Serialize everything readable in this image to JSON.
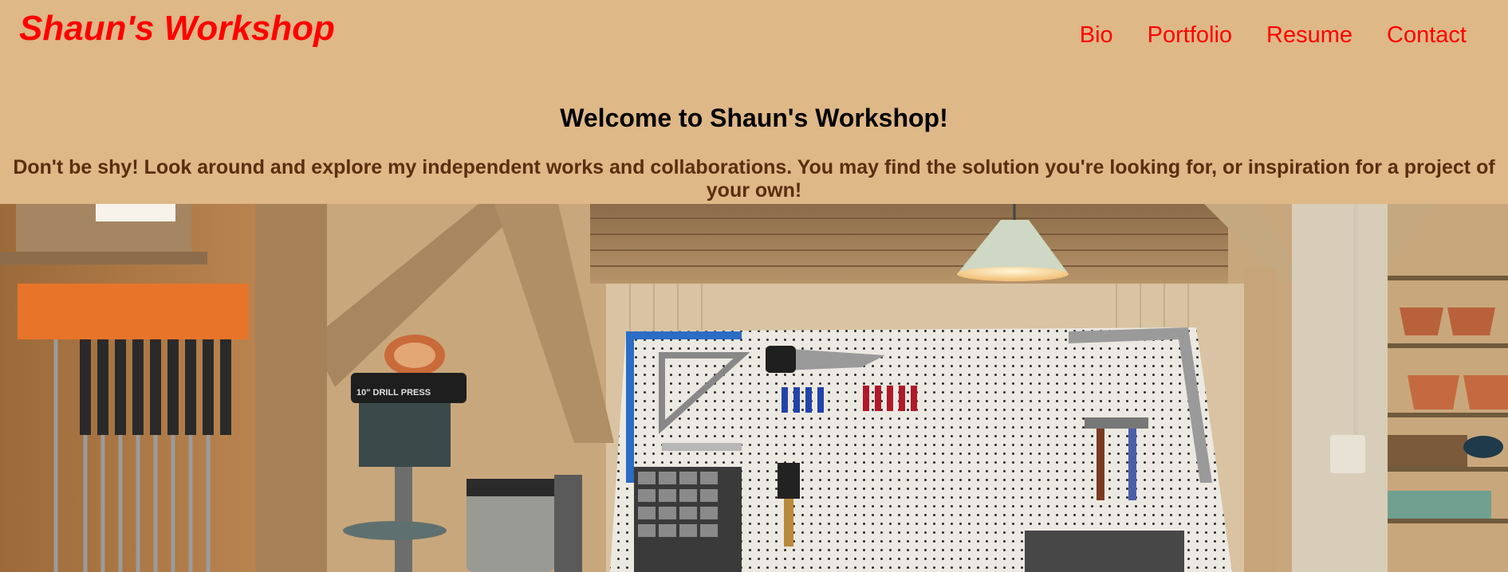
{
  "header": {
    "site_title": "Shaun's Workshop",
    "nav": [
      {
        "label": "Bio"
      },
      {
        "label": "Portfolio"
      },
      {
        "label": "Resume"
      },
      {
        "label": "Contact"
      }
    ]
  },
  "main": {
    "welcome_heading": "Welcome to Shaun's Workshop!",
    "intro_text": "Don't be shy! Look around and explore my independent works and collaborations. You may find the solution you're looking for, or inspiration for a project of your own!"
  },
  "hero_image": {
    "subject": "workshop-photo",
    "drill_press_label": "10\" DRILL PRESS"
  },
  "colors": {
    "background": "#DEB887",
    "accent": "#FF0000",
    "intro_text": "#5A2E0E"
  }
}
